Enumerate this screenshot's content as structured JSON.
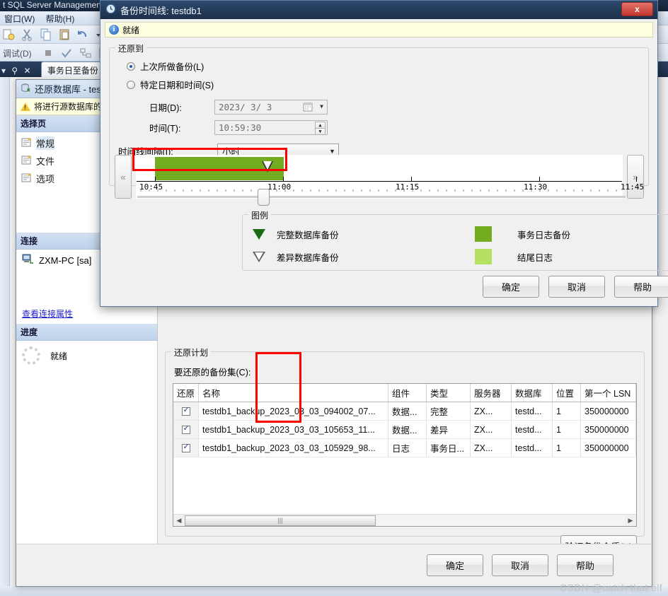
{
  "app": {
    "title": "t SQL Server Management",
    "menus": [
      "窗口(W)",
      "帮助(H)"
    ],
    "toolbar2_label": "调试(D)",
    "tab_label": "事务日至备份"
  },
  "restore_dialog": {
    "title": "还原数据库 - test",
    "warning": "将进行源数据库的",
    "pages_header": "选择页",
    "pages": [
      {
        "label": "常规",
        "selected": true
      },
      {
        "label": "文件",
        "selected": false
      },
      {
        "label": "选项",
        "selected": false
      }
    ],
    "connection_header": "连接",
    "connection_server": "ZXM-PC [sa]",
    "connection_link": "查看连接属性",
    "progress_header": "进度",
    "progress_status": "就绪",
    "plan_group": "还原计划",
    "plan_label": "要还原的备份集(C):",
    "table": {
      "headers": [
        "还原",
        "名称",
        "组件",
        "类型",
        "服务器",
        "数据库",
        "位置",
        "第一个 LSN"
      ],
      "rows": [
        {
          "restore": true,
          "name": "testdb1_backup_2023_03_03_094002_07...",
          "component": "数据...",
          "type": "完整",
          "server": "ZX...",
          "database": "testd...",
          "position": "1",
          "first_lsn": "350000000"
        },
        {
          "restore": true,
          "name": "testdb1_backup_2023_03_03_105653_11...",
          "component": "数据...",
          "type": "差异",
          "server": "ZX...",
          "database": "testd...",
          "position": "1",
          "first_lsn": "350000000"
        },
        {
          "restore": true,
          "name": "testdb1_backup_2023_03_03_105929_98...",
          "component": "日志",
          "type": "事务日...",
          "server": "ZX...",
          "database": "testd...",
          "position": "1",
          "first_lsn": "350000000"
        }
      ]
    },
    "verify_button": "验证备份介质(V)",
    "buttons": {
      "ok": "确定",
      "cancel": "取消",
      "help": "帮助"
    }
  },
  "timeline_dialog": {
    "title": "备份时间线: testdb1",
    "close_label": "x",
    "status": "就绪",
    "restore_to_group": "还原到",
    "option_last_backup": "上次所做备份(L)",
    "option_specific": "特定日期和时间(S)",
    "selected_option": "last_backup",
    "date_label": "日期(D):",
    "date_value": "2023/ 3/ 3",
    "time_label": "时间(T):",
    "time_value": "10:59:30",
    "interval_label": "时间线间隔(I):",
    "interval_value": "小时",
    "nav_prev": "«",
    "nav_next": "»",
    "axis_ticks": [
      "10:45",
      "11:00",
      "11:15",
      "11:30",
      "11:45"
    ],
    "legend_group": "图例",
    "legend": [
      {
        "icon": "solid-down-triangle",
        "label": "完整数据库备份"
      },
      {
        "icon": "hollow-down-triangle",
        "label": "差异数据库备份"
      },
      {
        "icon": "green-swatch",
        "label": "事务日志备份",
        "color": "#74ac21"
      },
      {
        "icon": "lightgreen-swatch",
        "label": "结尾日志",
        "color": "#b5e061"
      }
    ],
    "buttons": {
      "ok": "确定",
      "cancel": "取消",
      "help": "帮助"
    }
  },
  "chart_data": {
    "type": "bar",
    "title": "备份时间线: testdb1",
    "xlabel": "",
    "ylabel": "",
    "axis_ticks": [
      "10:45",
      "11:00",
      "11:15",
      "11:30",
      "11:45"
    ],
    "xlim": [
      "10:45",
      "11:45"
    ],
    "grid": false,
    "legend_position": "bottom",
    "series": [
      {
        "name": "事务日志备份",
        "color": "#74ac21",
        "segments": [
          {
            "start": "10:48",
            "end": "11:00"
          }
        ]
      },
      {
        "name": "差异数据库备份",
        "color": "#ffffff",
        "markers": [
          "10:56"
        ]
      }
    ],
    "selected_time": "10:59:30"
  },
  "watermark": "CSDN @catch that elf"
}
